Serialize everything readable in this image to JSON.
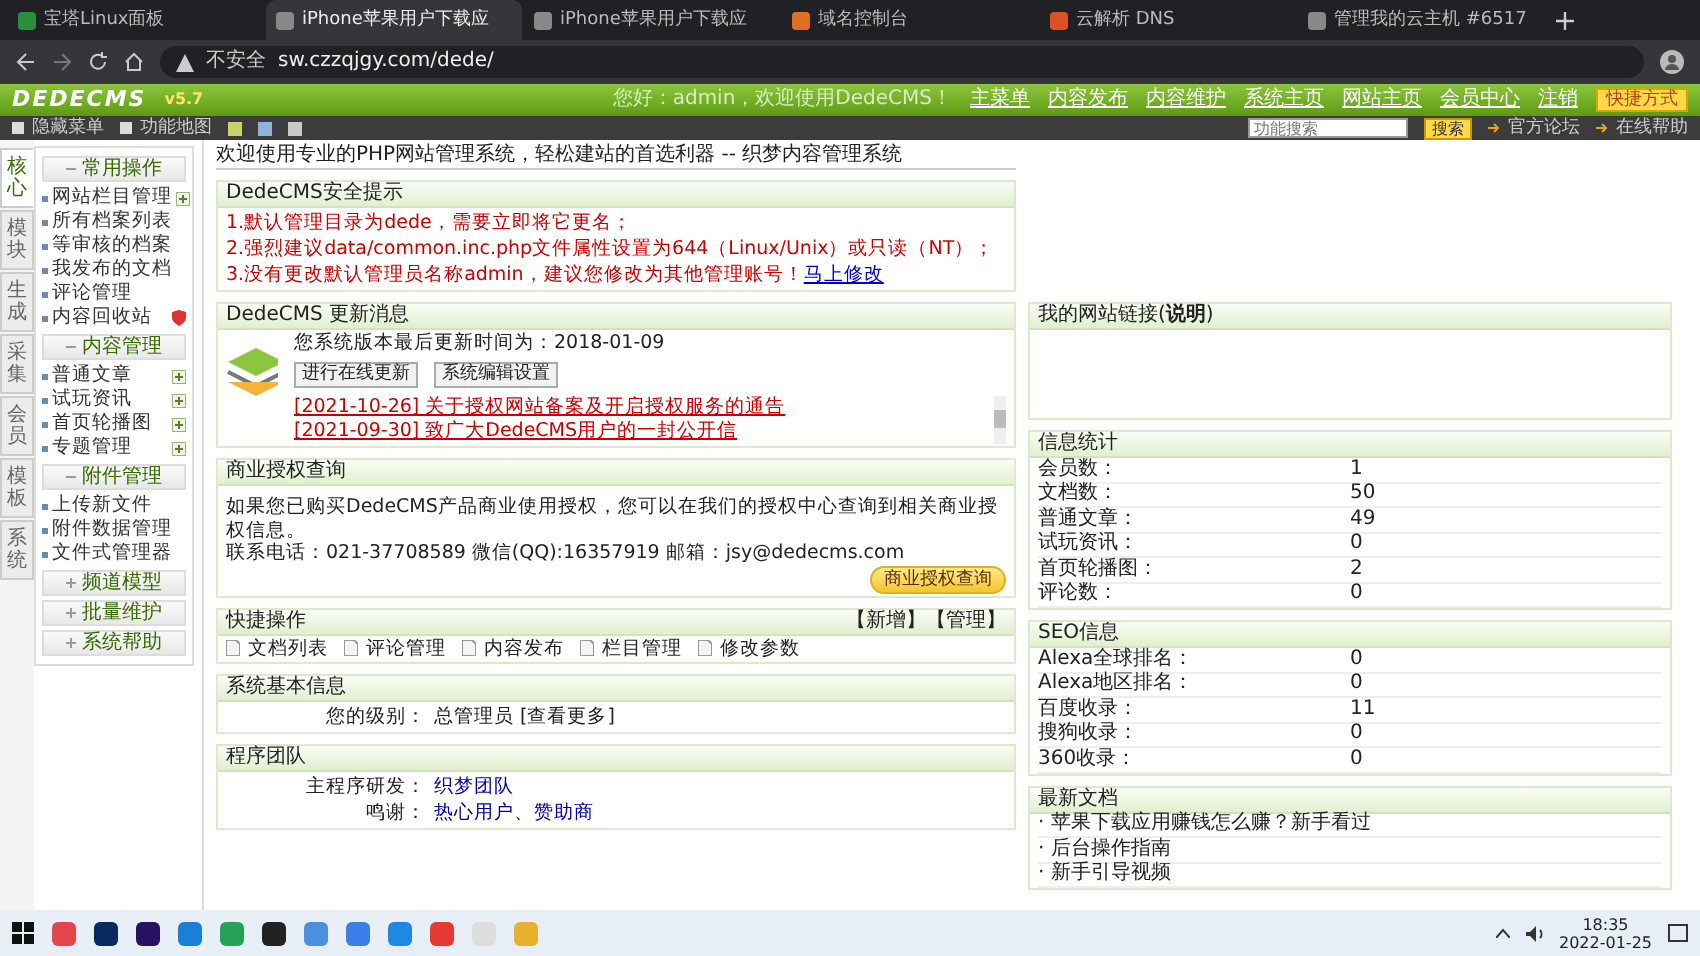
{
  "browser": {
    "tabs": [
      {
        "title": "宝塔Linux面板",
        "selected": false
      },
      {
        "title": "iPhone苹果用户下载应",
        "selected": true
      },
      {
        "title": "iPhone苹果用户下载应",
        "selected": false
      },
      {
        "title": "域名控制台",
        "selected": false
      },
      {
        "title": "云解析 DNS",
        "selected": false
      },
      {
        "title": "管理我的云主机 #6517",
        "selected": false
      }
    ],
    "security_label": "不安全",
    "url": "sw.czzqjgy.com/dede/"
  },
  "header": {
    "logo": "DEDECMS",
    "version": "v5.7",
    "greeting": "您好：admin，欢迎使用DedeCMS！",
    "nav": [
      "主菜单",
      "内容发布",
      "内容维护",
      "系统主页",
      "网站主页",
      "会员中心",
      "注销"
    ],
    "shortcut": "快捷方式"
  },
  "toolbar": {
    "links": [
      "隐藏菜单",
      "功能地图"
    ],
    "skins": [
      {
        "color": "#c8d36a"
      },
      {
        "color": "#8fb2d8"
      },
      {
        "color": "#c9c9c9"
      }
    ],
    "search_placeholder": "功能搜索",
    "search_button": "搜索",
    "right_links": [
      "官方论坛",
      "在线帮助"
    ]
  },
  "side_tabs": [
    {
      "label": "核心",
      "selected": true
    },
    {
      "label": "模块",
      "selected": false
    },
    {
      "label": "生成",
      "selected": false
    },
    {
      "label": "采集",
      "selected": false
    },
    {
      "label": "会员",
      "selected": false
    },
    {
      "label": "模板",
      "selected": false
    },
    {
      "label": "系统",
      "selected": false
    }
  ],
  "menu": [
    {
      "title": "常用操作",
      "expanded": true,
      "items": [
        {
          "label": "网站栏目管理",
          "kind": "add"
        },
        {
          "label": "所有档案列表",
          "kind": "plain"
        },
        {
          "label": "等审核的档案",
          "kind": "plain"
        },
        {
          "label": "我发布的文档",
          "kind": "plain"
        },
        {
          "label": "评论管理",
          "kind": "plain"
        },
        {
          "label": "内容回收站",
          "kind": "trash"
        }
      ]
    },
    {
      "title": "内容管理",
      "expanded": true,
      "items": [
        {
          "label": "普通文章",
          "kind": "add"
        },
        {
          "label": "试玩资讯",
          "kind": "add"
        },
        {
          "label": "首页轮播图",
          "kind": "add"
        },
        {
          "label": "专题管理",
          "kind": "add"
        }
      ]
    },
    {
      "title": "附件管理",
      "expanded": true,
      "items": [
        {
          "label": "上传新文件",
          "kind": "plain"
        },
        {
          "label": "附件数据管理",
          "kind": "plain"
        },
        {
          "label": "文件式管理器",
          "kind": "plain"
        }
      ]
    },
    {
      "title": "频道模型",
      "expanded": false
    },
    {
      "title": "批量维护",
      "expanded": false
    },
    {
      "title": "系统帮助",
      "expanded": false
    }
  ],
  "welcome": "欢迎使用专业的PHP网站管理系统，轻松建站的首选利器 -- 织梦内容管理系统",
  "security": {
    "title": "DedeCMS安全提示",
    "lines": [
      "1.默认管理目录为dede，需要立即将它更名；",
      "2.强烈建议data/common.inc.php文件属性设置为644（Linux/Unix）或只读（NT）；",
      "3.没有更改默认管理员名称admin，建议您修改为其他管理账号！"
    ],
    "fix_link": "马上修改"
  },
  "updates": {
    "title": "DedeCMS 更新消息",
    "version_line": "您系统版本最后更新时间为：2018-01-09",
    "buttons": [
      "进行在线更新",
      "系统编辑设置"
    ],
    "news": [
      "[2021-10-26] 关于授权网站备案及开启授权服务的通告",
      "[2021-09-30] 致广大DedeCMS用户的一封公开信"
    ]
  },
  "links_panel": {
    "title": "我的网站链接(**说明**)"
  },
  "license": {
    "title": "商业授权查询",
    "text": "如果您已购买DedeCMS产品商业使用授权，您可以在我们的授权中心查询到相关商业授权信息。",
    "contact": "联系电话：021-37708589 微信(QQ):16357919 邮箱：jsy@dedecms.com",
    "button": "商业授权查询"
  },
  "quick": {
    "title": "快捷操作",
    "actions": [
      "【新增】",
      "【管理】"
    ],
    "items": [
      "文档列表",
      "评论管理",
      "内容发布",
      "栏目管理",
      "修改参数"
    ]
  },
  "sysinfo": {
    "title": "系统基本信息",
    "rows": [
      {
        "label": "您的级别：",
        "value": "总管理员 [查看更多]"
      }
    ]
  },
  "team": {
    "title": "程序团队",
    "rows": [
      {
        "label": "主程序研发：",
        "value": "织梦团队"
      },
      {
        "label": "鸣谢：",
        "value": "热心用户、赞助商"
      }
    ]
  },
  "stats": {
    "title": "信息统计",
    "rows": [
      {
        "label": "会员数：",
        "value": "1"
      },
      {
        "label": "文档数：",
        "value": "50"
      },
      {
        "label": "普通文章：",
        "value": "49"
      },
      {
        "label": "试玩资讯：",
        "value": "0"
      },
      {
        "label": "首页轮播图：",
        "value": "2"
      },
      {
        "label": "评论数：",
        "value": "0"
      }
    ]
  },
  "seo": {
    "title": "SEO信息",
    "rows": [
      {
        "label": "Alexa全球排名：",
        "value": "0"
      },
      {
        "label": "Alexa地区排名：",
        "value": "0"
      },
      {
        "label": "百度收录：",
        "value": "11"
      },
      {
        "label": "搜狗收录：",
        "value": "0"
      },
      {
        "label": "360收录：",
        "value": "0"
      }
    ]
  },
  "latest": {
    "title": "最新文档",
    "items": [
      "· 苹果下载应用赚钱怎么赚？新手看过",
      "· 后台操作指南",
      "· 新手引导视频"
    ]
  },
  "taskbar": {
    "time": "18:35",
    "date": "2022-01-25"
  }
}
